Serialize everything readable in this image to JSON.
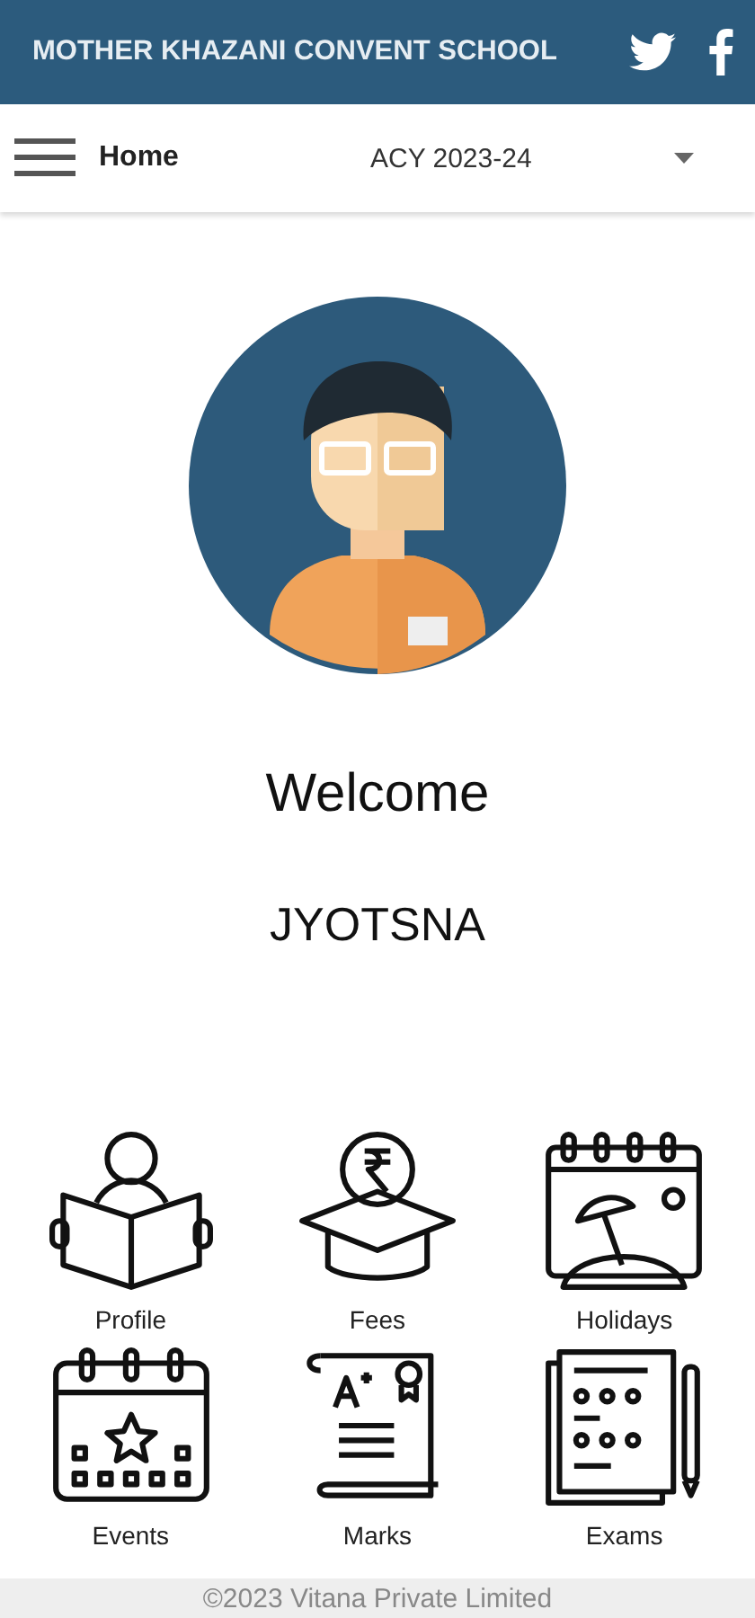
{
  "header": {
    "title": "MOTHER KHAZANI CONVENT SCHOOL"
  },
  "nav": {
    "page": "Home",
    "year": "ACY 2023-24"
  },
  "welcome": "Welcome",
  "user_name": "JYOTSNA",
  "menu": [
    {
      "label": "Profile",
      "kind": "profile"
    },
    {
      "label": "Fees",
      "kind": "fees"
    },
    {
      "label": "Holidays",
      "kind": "holidays"
    },
    {
      "label": "Events",
      "kind": "events"
    },
    {
      "label": "Marks",
      "kind": "marks"
    },
    {
      "label": "Exams",
      "kind": "exams"
    }
  ],
  "footer": "©2023 Vitana Private Limited"
}
